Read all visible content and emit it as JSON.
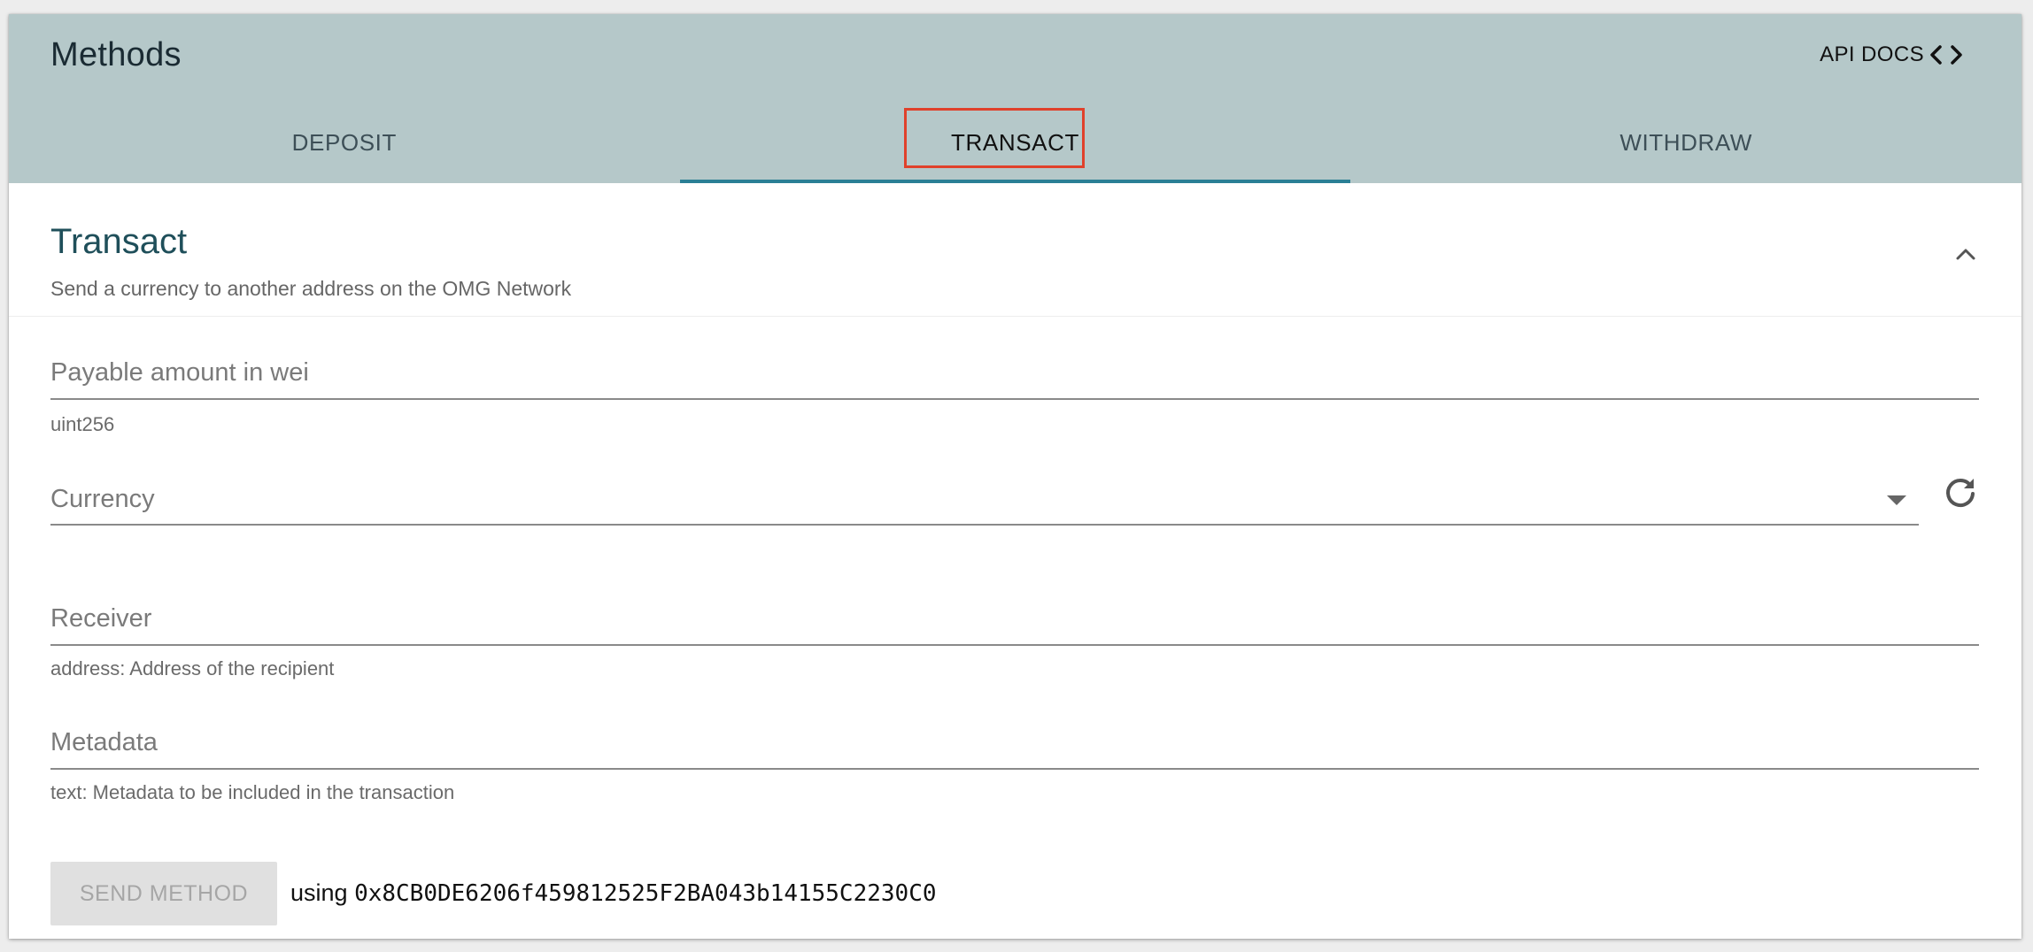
{
  "header": {
    "title": "Methods",
    "api_docs_label": "API DOCS",
    "api_docs_icon": "code-brackets-icon"
  },
  "tabs": [
    {
      "label": "DEPOSIT",
      "active": false
    },
    {
      "label": "TRANSACT",
      "active": true
    },
    {
      "label": "WITHDRAW",
      "active": false
    }
  ],
  "section": {
    "title": "Transact",
    "subtitle": "Send a currency to another address on the OMG Network",
    "collapse_icon": "chevron-up-icon"
  },
  "form": {
    "amount": {
      "placeholder": "Payable amount in wei",
      "helper": "uint256"
    },
    "currency": {
      "placeholder": "Currency",
      "refresh_icon": "refresh-icon"
    },
    "receiver": {
      "placeholder": "Receiver",
      "helper": "address: Address of the recipient"
    },
    "metadata": {
      "placeholder": "Metadata",
      "helper": "text: Metadata to be included in the transaction"
    }
  },
  "footer": {
    "send_label": "SEND METHOD",
    "using_label": "using",
    "address": "0x8CB0DE6206f459812525F2BA043b14155C2230C0"
  },
  "colors": {
    "header_bg": "#b5c8c9",
    "active_tab_indicator": "#2a7f95",
    "highlight": "#e0412b",
    "section_title": "#1f4f5a"
  }
}
